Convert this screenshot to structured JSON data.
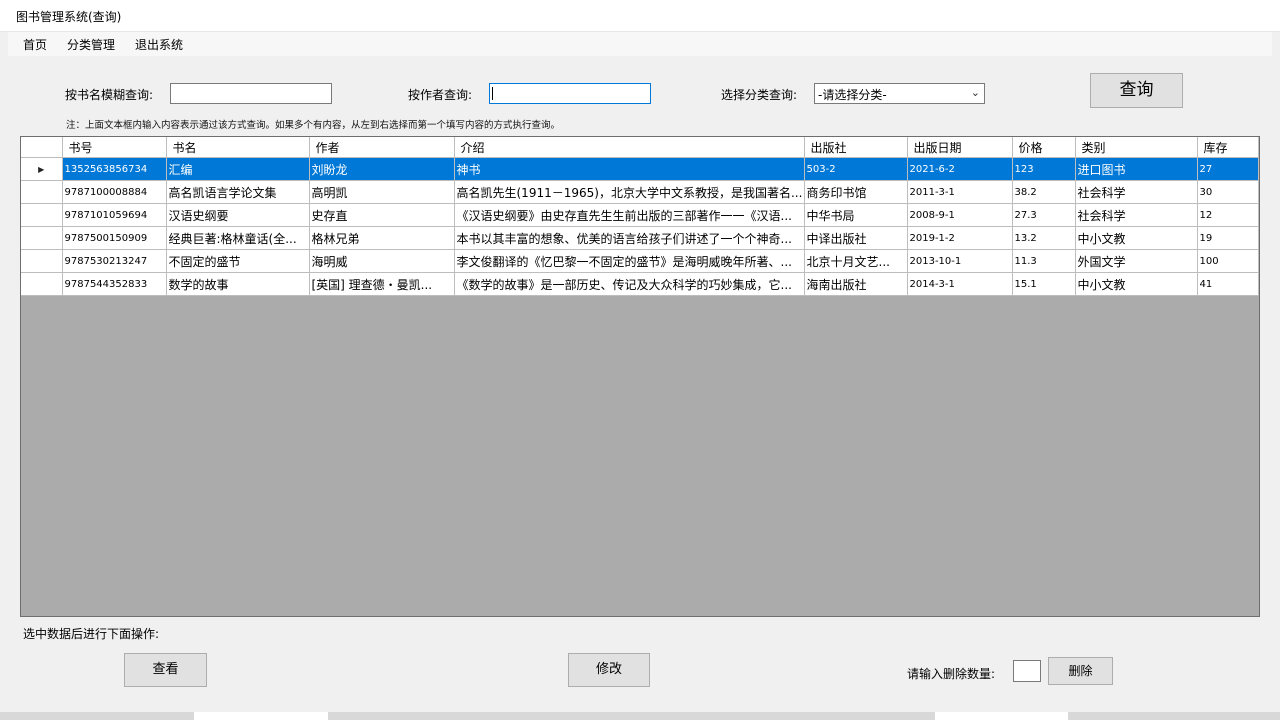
{
  "window": {
    "title": "图书管理系统(查询)"
  },
  "menu": {
    "items": [
      "首页",
      "分类管理",
      "退出系统"
    ]
  },
  "search": {
    "name_label": "按书名模糊查询:",
    "name_value": "",
    "author_label": "按作者查询:",
    "author_value": "",
    "category_label": "选择分类查询:",
    "category_value": "-请选择分类-",
    "query_button": "查询",
    "note": "注：上面文本框内输入内容表示通过该方式查询。如果多个有内容，从左到右选择而第一个填写内容的方式执行查询。"
  },
  "table": {
    "columns": [
      "书号",
      "书名",
      "作者",
      "介绍",
      "出版社",
      "出版日期",
      "价格",
      "类别",
      "库存"
    ],
    "rows": [
      [
        "1352563856734",
        "汇编",
        "刘盼龙",
        "神书",
        "503-2",
        "2021-6-2",
        "123",
        "进口图书",
        "27"
      ],
      [
        "9787100008884",
        "高名凯语言学论文集",
        "高明凯",
        "高名凯先生(1911－1965)，北京大学中文系教授，是我国著名...",
        "商务印书馆",
        "2011-3-1",
        "38.2",
        "社会科学",
        "30"
      ],
      [
        "9787101059694",
        "汉语史纲要",
        "史存直",
        "《汉语史纲要》由史存直先生生前出版的三部著作一一《汉语...",
        "中华书局",
        "2008-9-1",
        "27.3",
        "社会科学",
        "12"
      ],
      [
        "9787500150909",
        "经典巨著:格林童话(全...",
        "格林兄弟",
        "本书以其丰富的想象、优美的语言给孩子们讲述了一个个神奇...",
        "中译出版社",
        "2019-1-2",
        "13.2",
        "中小文教",
        "19"
      ],
      [
        "9787530213247",
        "不固定的盛节",
        "海明威",
        "李文俊翻译的《忆巴黎一不固定的盛节》是海明威晚年所著、...",
        "北京十月文艺...",
        "2013-10-1",
        "11.3",
        "外国文学",
        "100"
      ],
      [
        "9787544352833",
        "数学的故事",
        "[英国] 理查德・曼凯...",
        "《数学的故事》是一部历史、传记及大众科学的巧妙集成，它...",
        "海南出版社",
        "2014-3-1",
        "15.1",
        "中小文教",
        "41"
      ]
    ],
    "selected_row": 0
  },
  "actions": {
    "hint": "选中数据后进行下面操作:",
    "view_button": "查看",
    "edit_button": "修改",
    "delete_label": "请输入删除数量:",
    "delete_value": "",
    "delete_button": "删除"
  },
  "colors": {
    "selection": "#0078d7",
    "grid_background": "#ababab"
  }
}
